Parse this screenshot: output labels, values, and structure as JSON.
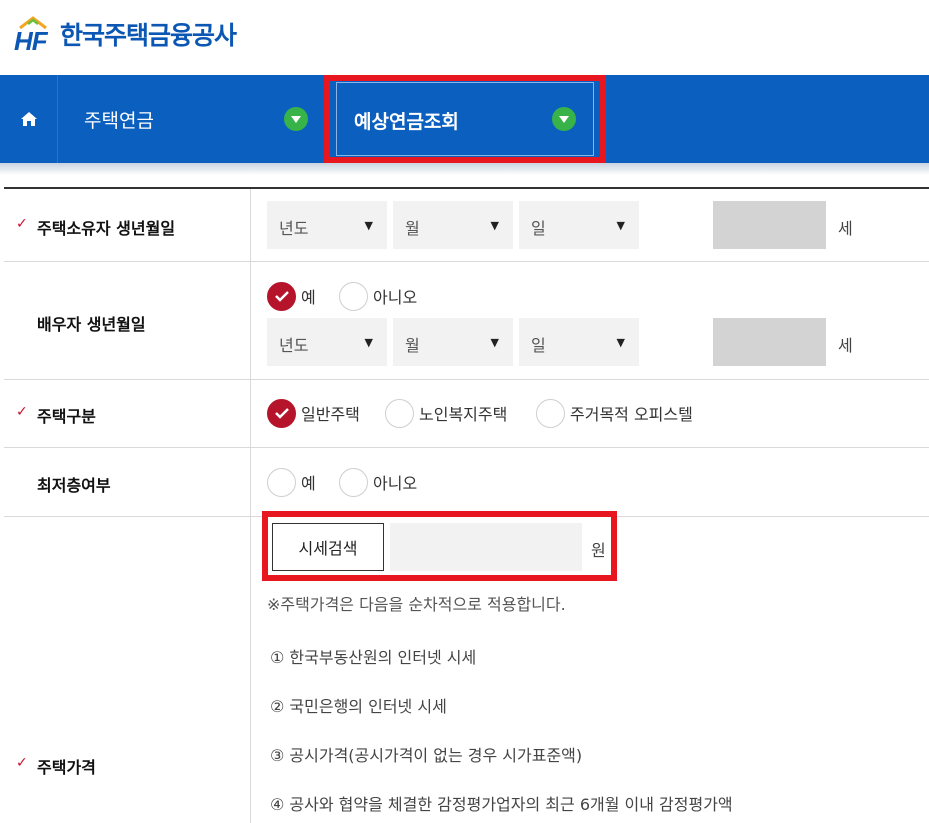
{
  "header": {
    "logo_text": "한국주택금융공사",
    "logo_mark": "HF"
  },
  "nav": {
    "home_icon": "home-icon",
    "items": [
      {
        "label": "주택연금"
      },
      {
        "label": "예상연금조회"
      }
    ]
  },
  "form": {
    "owner_birth": {
      "label": "주택소유자 생년월일",
      "year": "년도",
      "month": "월",
      "day": "일",
      "age_unit": "세"
    },
    "spouse_birth": {
      "label": "배우자 생년월일",
      "options": [
        "예",
        "아니오"
      ],
      "selected": "예",
      "year": "년도",
      "month": "월",
      "day": "일",
      "age_unit": "세"
    },
    "house_type": {
      "label": "주택구분",
      "options": [
        "일반주택",
        "노인복지주택",
        "주거목적 오피스텔"
      ],
      "selected": "일반주택"
    },
    "lowest_floor": {
      "label": "최저층여부",
      "options": [
        "예",
        "아니오"
      ],
      "selected": ""
    },
    "house_price": {
      "label": "주택가격",
      "search_button": "시세검색",
      "input_value": "",
      "unit": "원",
      "notes": [
        "※주택가격은 다음을 순차적으로 적용합니다.",
        "①  한국부동산원의 인터넷 시세",
        "②  국민은행의 인터넷 시세",
        "③  공시가격(공시가격이 없는 경우 시가표준액)",
        "④  공사와 협약을 체결한 감정평가업자의 최근 6개월 이내 감정평가액"
      ]
    }
  },
  "colors": {
    "brand_blue": "#0b5fbf",
    "chevron_green": "#38b34a",
    "highlight_red": "#e8161e",
    "radio_checked": "#b5142b"
  }
}
